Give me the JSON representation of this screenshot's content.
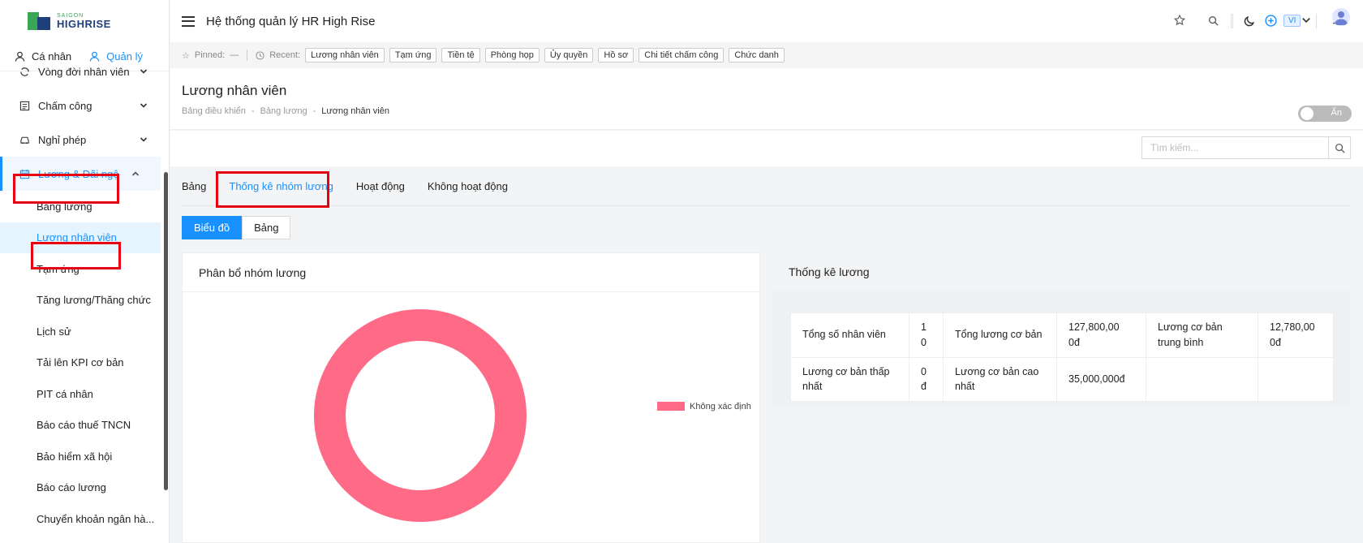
{
  "logo": {
    "line1": "SAIGON",
    "line2": "HIGHRISE"
  },
  "sidebar": {
    "tabs": [
      {
        "label": "Cá nhân"
      },
      {
        "label": "Quản lý"
      }
    ],
    "items": [
      {
        "label": "Vòng đời nhân viên"
      },
      {
        "label": "Chấm công"
      },
      {
        "label": "Nghỉ phép"
      },
      {
        "label": "Lương & Đãi ngộ"
      }
    ],
    "subitems": [
      {
        "label": "Bảng lương"
      },
      {
        "label": "Lương nhân viên"
      },
      {
        "label": "Tạm ứng"
      },
      {
        "label": "Tăng lương/Thăng chức"
      },
      {
        "label": "Lịch sử"
      },
      {
        "label": "Tải lên KPI cơ bản"
      },
      {
        "label": "PIT cá nhân"
      },
      {
        "label": "Báo cáo thuế TNCN"
      },
      {
        "label": "Bảo hiểm xã hội"
      },
      {
        "label": "Báo cáo lương"
      },
      {
        "label": "Chuyển khoản ngân hà..."
      }
    ]
  },
  "header": {
    "title": "Hệ thống quản lý HR High Rise",
    "lang": "VI"
  },
  "pinbar": {
    "pinned_label": "Pinned:",
    "pinned_value": "—",
    "recent_label": "Recent:",
    "recent": [
      "Lương nhân viên",
      "Tạm ứng",
      "Tiền tệ",
      "Phòng họp",
      "Ủy quyền",
      "Hồ sơ",
      "Chi tiết chấm công",
      "Chức danh"
    ]
  },
  "page": {
    "title": "Lương nhân viên",
    "breadcrumb": [
      "Bảng điều khiển",
      "Bảng lương",
      "Lương nhân viên"
    ],
    "toggle_label": "Ẩn"
  },
  "search": {
    "placeholder": "Tìm kiếm..."
  },
  "tabs": [
    "Bảng",
    "Thống kê nhóm lương",
    "Hoạt động",
    "Không hoạt động"
  ],
  "view_toggle": [
    "Biểu đồ",
    "Bảng"
  ],
  "chart_card": {
    "title": "Phân bổ nhóm lương"
  },
  "chart_data": {
    "type": "pie",
    "donut": true,
    "title": "Phân bổ nhóm lương",
    "categories": [
      "Không xác định"
    ],
    "values": [
      100
    ],
    "colors": [
      "#ff6b86"
    ],
    "legend": "right"
  },
  "stats_card": {
    "title": "Thống kê lương",
    "rows": [
      [
        "Tổng số nhân viên",
        "1\n0",
        "Tổng lương cơ bản",
        "127,800,00\n0đ",
        "Lương cơ bản trung bình",
        "12,780,00\n0đ"
      ],
      [
        "Lương cơ bản thấp nhất",
        "0\nđ",
        "Lương cơ bản cao nhất",
        "35,000,000đ",
        "",
        ""
      ]
    ]
  }
}
